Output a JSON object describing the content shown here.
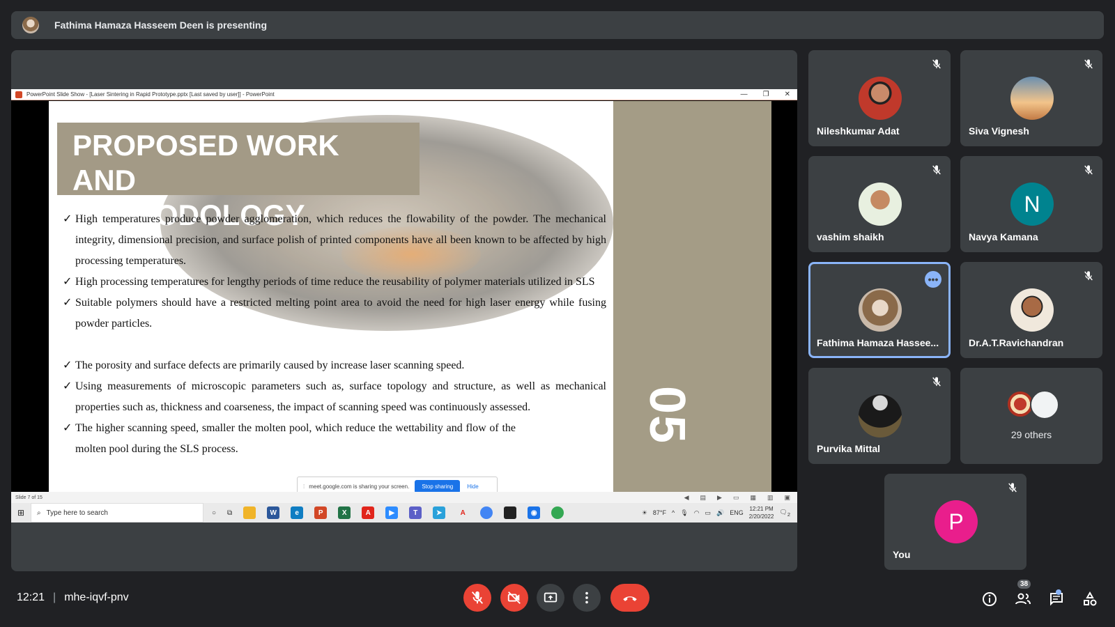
{
  "banner": {
    "text": "Fathima Hamaza Hasseem Deen is presenting"
  },
  "presentation": {
    "window_title": "PowerPoint Slide Show - [Laser Sintering in Rapid Prototype.pptx [Last saved by user]] - PowerPoint",
    "slide_title_line1": "PROPOSED WORK AND",
    "slide_title_line2": "METHODOLOGY",
    "slide_number": "05",
    "bullets": [
      "High temperatures produce powder agglomeration, which reduces the flowability of the powder. The mechanical integrity, dimensional precision, and surface polish of printed components have all been known to be affected by high processing temperatures.",
      "High processing temperatures for lengthy periods of time reduce the reusability of polymer materials utilized in SLS",
      "Suitable polymers should have a restricted melting point area to avoid the need for high laser energy while fusing powder particles.",
      "The porosity and surface defects are primarily caused by increase laser scanning speed.",
      "Using measurements of microscopic parameters such as, surface topology and structure, as well as mechanical properties such as, thickness and coarseness, the impact of scanning speed was continuously assessed.",
      "The higher scanning speed, smaller the molten pool, which reduce the wettability and flow of the molten pool during the SLS process."
    ],
    "tick": "✓",
    "status_left": "Slide 7 of 15",
    "share_text": "meet.google.com is sharing your screen.",
    "stop_sharing": "Stop sharing",
    "hide": "Hide"
  },
  "taskbar": {
    "search_placeholder": "Type here to search",
    "weather": "87°F",
    "lang": "ENG",
    "time": "12:21 PM",
    "date": "2/20/2022",
    "notif_count": "2"
  },
  "participants": [
    {
      "name": "Nileshkumar Adat",
      "muted": true
    },
    {
      "name": "Siva Vignesh",
      "muted": true
    },
    {
      "name": "vashim shaikh",
      "muted": true
    },
    {
      "name": "Navya Kamana",
      "initial": "N",
      "muted": true
    },
    {
      "name": "Fathima Hamaza Hassee...",
      "muted": false,
      "active": true
    },
    {
      "name": "Dr.A.T.Ravichandran",
      "muted": true
    },
    {
      "name": "Purvika Mittal",
      "muted": true
    },
    {
      "name": "29 others"
    },
    {
      "name": "You",
      "initial": "P",
      "muted": true
    }
  ],
  "meeting": {
    "time": "12:21",
    "separator": "|",
    "code": "mhe-iqvf-pnv",
    "people_count": "38"
  },
  "colors": {
    "background": "#202124",
    "tile": "#3c4043",
    "danger": "#ea4335",
    "accent": "#8ab4f8",
    "navya_avatar": "#00838f",
    "you_avatar": "#e91e8c"
  }
}
